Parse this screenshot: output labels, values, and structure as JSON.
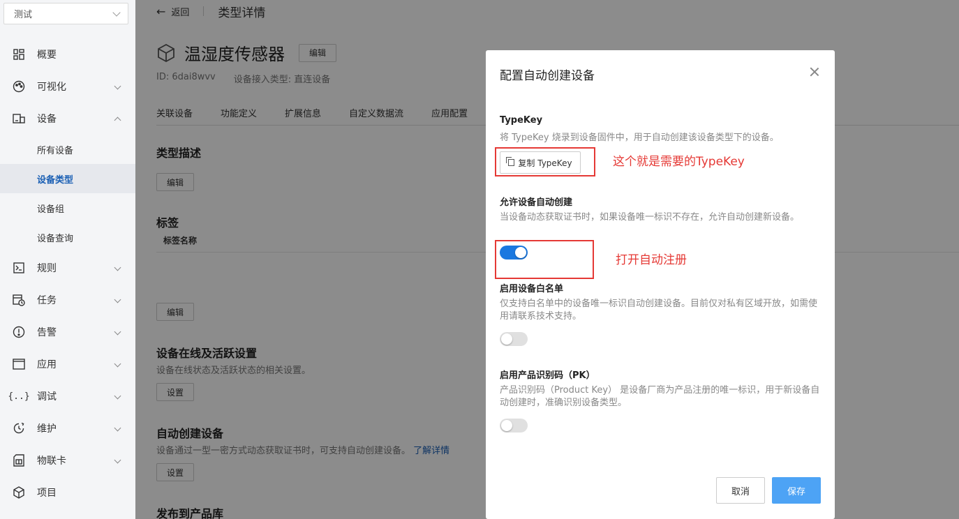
{
  "project_select": {
    "value": "测试"
  },
  "sidebar": {
    "items": [
      {
        "label": "概要",
        "icon": "dashboard-icon",
        "has_arrow": false
      },
      {
        "label": "可视化",
        "icon": "palette-icon",
        "has_arrow": true
      },
      {
        "label": "设备",
        "icon": "devices-icon",
        "has_arrow": true,
        "expanded": true
      },
      {
        "label": "规则",
        "icon": "terminal-icon",
        "has_arrow": true
      },
      {
        "label": "任务",
        "icon": "task-icon",
        "has_arrow": true
      },
      {
        "label": "告警",
        "icon": "alert-icon",
        "has_arrow": true
      },
      {
        "label": "应用",
        "icon": "app-window-icon",
        "has_arrow": true
      },
      {
        "label": "调试",
        "icon": "code-braces-icon",
        "has_arrow": true
      },
      {
        "label": "维护",
        "icon": "maintenance-icon",
        "has_arrow": true
      },
      {
        "label": "物联卡",
        "icon": "sim-card-icon",
        "has_arrow": true
      },
      {
        "label": "项目",
        "icon": "cube-icon",
        "has_arrow": false
      }
    ],
    "device_sub": [
      "所有设备",
      "设备类型",
      "设备组",
      "设备查询"
    ],
    "active_sub": "设备类型"
  },
  "topbar": {
    "back_label": "返回",
    "title": "类型详情"
  },
  "device_type": {
    "name": "温湿度传感器",
    "edit_label": "编辑",
    "id_text": "ID: 6dai8wvv",
    "access_text": "设备接入类型: 直连设备"
  },
  "tabs": [
    "关联设备",
    "功能定义",
    "扩展信息",
    "自定义数据流",
    "应用配置"
  ],
  "sections": {
    "desc_title": "类型描述",
    "desc_edit": "编辑",
    "tags_title": "标签",
    "tags_col": "标签名称",
    "tags_edit": "编辑",
    "online_title": "设备在线及活跃设置",
    "online_desc": "设备在线状态及活跃状态的相关设置。",
    "online_btn": "设置",
    "auto_title": "自动创建设备",
    "auto_desc": "设备通过一型一密方式动态获取证书时，可支持自动创建设备。",
    "auto_link": "了解详情",
    "auto_btn": "设置",
    "publish_title": "发布到产品库"
  },
  "modal": {
    "title": "配置自动创建设备",
    "typekey_label": "TypeKey",
    "typekey_desc": "将 TypeKey 烧录到设备固件中，用于自动创建该设备类型下的设备。",
    "copy_label": "复制 TypeKey",
    "auto_label": "允许设备自动创建",
    "auto_desc": "当设备动态获取证书时，如果设备唯一标识不存在，允许自动创建新设备。",
    "auto_on": true,
    "whitelist_label": "启用设备白名单",
    "whitelist_desc": "仅支持白名单中的设备唯一标识自动创建设备。目前仅对私有区域开放，如需使用请联系技术支持。",
    "whitelist_on": false,
    "pk_label": "启用产品识别码（PK）",
    "pk_desc": "产品识别码（Product Key） 是设备厂商为产品注册的唯一标识，用于新设备自动创建时，准确识别设备类型。",
    "pk_on": false,
    "cancel_label": "取消",
    "save_label": "保存"
  },
  "annotations": {
    "typekey_note": "这个就是需要的TypeKey",
    "auto_note": "打开自动注册"
  },
  "colors": {
    "accent": "#1a78e0",
    "save_button": "#4da3f5",
    "annotation": "#e53935"
  }
}
